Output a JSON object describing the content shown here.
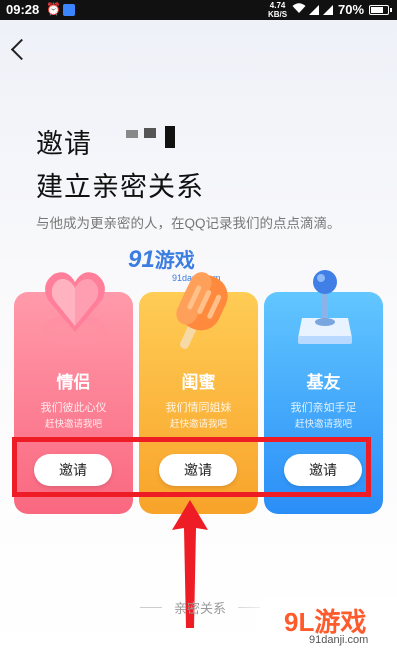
{
  "status_bar": {
    "time": "09:28",
    "speed_value": "4.74",
    "speed_unit": "KB/S",
    "battery": "70%"
  },
  "header": {
    "title_line1": "邀请",
    "title_line2": "建立亲密关系",
    "subtitle": "与他成为更亲密的人，在QQ记录我们的点点滴滴。"
  },
  "cards": [
    {
      "id": "lover",
      "title": "情侣",
      "desc": "我们彼此心仪",
      "hint": "赶快邀请我吧",
      "button": "邀请",
      "color": "#fa6880"
    },
    {
      "id": "bestie",
      "title": "闺蜜",
      "desc": "我们情同姐妹",
      "hint": "赶快邀请我吧",
      "button": "邀请",
      "color": "#f8a32a"
    },
    {
      "id": "buddy",
      "title": "基友",
      "desc": "我们亲如手足",
      "hint": "赶快邀请我吧",
      "button": "邀请",
      "color": "#2a8ef8"
    }
  ],
  "section_label": "亲密关系",
  "watermarks": {
    "center_num": "91",
    "center_text": "游戏",
    "center_url": "91danji.com",
    "corner_logo": "9L游戏",
    "corner_url": "91danji.com"
  },
  "icons": {
    "back": "chevron-left-icon",
    "lover": "heart-icon",
    "bestie": "popsicle-icon",
    "buddy": "joystick-icon"
  },
  "annotation_color": "#ee1c24"
}
